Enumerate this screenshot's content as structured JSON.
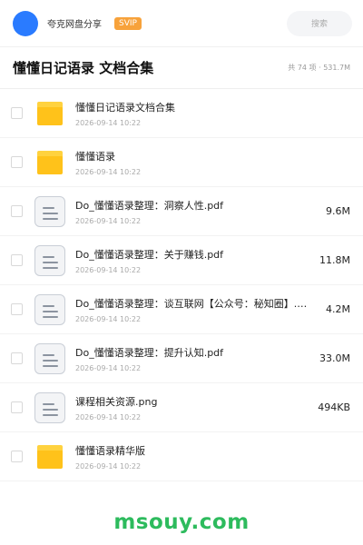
{
  "header": {
    "user_name": "夸克网盘分享",
    "badge": "SVIP",
    "search_placeholder": "搜索",
    "avatar_color": "#2a7bff"
  },
  "title_bar": {
    "title": "懂懂日记语录 文档合集",
    "summary": "共 74 项 · 531.7M"
  },
  "files": [
    {
      "type": "folder",
      "name": "懂懂日记语录文档合集",
      "date": "2026-09-14 10:22",
      "size": ""
    },
    {
      "type": "folder",
      "name": "懂懂语录",
      "date": "2026-09-14 10:22",
      "size": ""
    },
    {
      "type": "doc",
      "name": "Do_懂懂语录整理：洞察人性.pdf",
      "date": "2026-09-14 10:22",
      "size": "9.6M"
    },
    {
      "type": "doc",
      "name": "Do_懂懂语录整理：关于赚钱.pdf",
      "date": "2026-09-14 10:22",
      "size": "11.8M"
    },
    {
      "type": "doc",
      "name": "Do_懂懂语录整理：谈互联网【公众号：秘知圈】.pdf",
      "date": "2026-09-14 10:22",
      "size": "4.2M"
    },
    {
      "type": "doc",
      "name": "Do_懂懂语录整理：提升认知.pdf",
      "date": "2026-09-14 10:22",
      "size": "33.0M"
    },
    {
      "type": "doc",
      "name": "课程相关资源.png",
      "date": "2026-09-14 10:22",
      "size": "494KB"
    },
    {
      "type": "folder",
      "name": "懂懂语录精华版",
      "date": "2026-09-14 10:22",
      "size": ""
    }
  ],
  "watermark": "msouy.com",
  "colors": {
    "folder": "#ffc21a",
    "badge": "#f7a23b",
    "watermark": "#2dbb5d"
  }
}
